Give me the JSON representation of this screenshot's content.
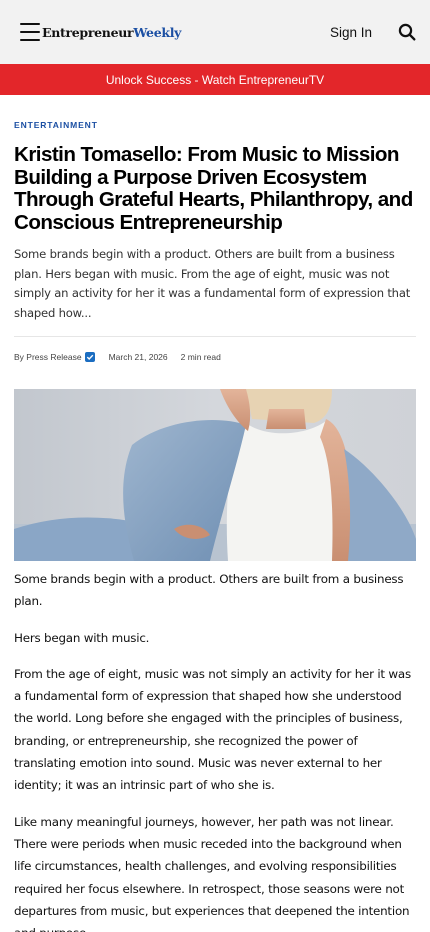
{
  "header": {
    "logo_part1": "Entrepreneur",
    "logo_part2": "Weekly",
    "signin_label": "Sign In"
  },
  "banner": {
    "text": "Unlock Success - Watch EntrepreneurTV"
  },
  "article": {
    "category": "ENTERTAINMENT",
    "title": "Kristin Tomasello: From Music to Mission Building a Purpose Driven Ecosystem Through Grateful Hearts, Philanthropy, and Conscious Entrepreneurship",
    "excerpt": "Some brands begin with a product. Others are built from a business plan. Hers began with music. From the age of eight, music was not simply an activity for her it was a fundamental form of expression that shaped how...",
    "author": "By Press Release",
    "date": "March 21, 2026",
    "read_time": "2 min read",
    "paragraphs": [
      "Some brands begin with a product. Others are built from a business plan.",
      "Hers began with music.",
      "From the age of eight, music was not simply an activity for her it was a fundamental form of expression that shaped how she understood the world. Long before she engaged with the principles of business, branding, or entrepreneurship, she recognized the power of translating emotion into sound. Music was never external to her identity; it was an intrinsic part of who she is.",
      "Like many meaningful journeys, however, her path was not linear. There were periods when music receded into the background when life circumstances, health challenges, and evolving responsibilities required her focus elsewhere. In retrospect, those seasons were not departures from music, but experiences that deepened the intention and purpose"
    ]
  },
  "icons": {
    "menu": "hamburger-menu-icon",
    "search": "search-icon",
    "verified": "verified-check-icon"
  },
  "colors": {
    "banner": "#e3262a",
    "brand_blue": "#1b4fa3",
    "category": "#1b4fa3",
    "verified": "#1b6dc1"
  }
}
